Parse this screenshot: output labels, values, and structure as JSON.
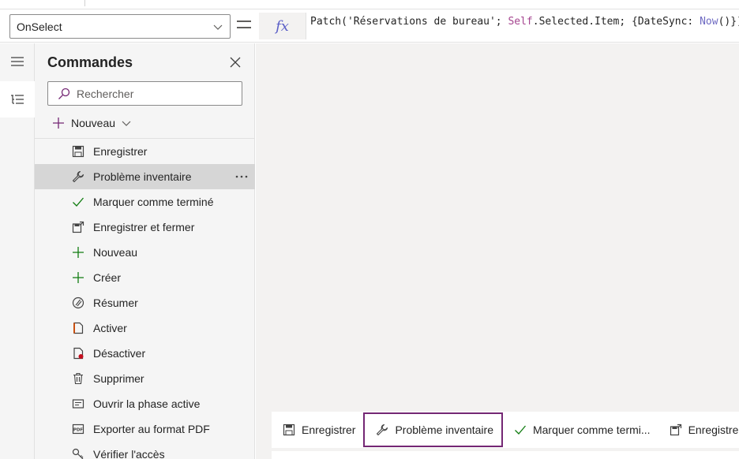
{
  "formula": {
    "property": "OnSelect",
    "fx_label": "fx",
    "parts": {
      "p1": "Patch('Réservations de bureau'; ",
      "p2": "Self",
      "p3": ".Selected.Item; {DateSync: ",
      "p4": "Now",
      "p5": "()})"
    }
  },
  "panel": {
    "title": "Commandes",
    "search_placeholder": "Rechercher",
    "new_label": "Nouveau",
    "commands": [
      {
        "label": "Enregistrer",
        "icon": "save-icon"
      },
      {
        "label": "Problème inventaire",
        "icon": "wrench-icon",
        "selected": true
      },
      {
        "label": "Marquer comme terminé",
        "icon": "checkmark-icon"
      },
      {
        "label": "Enregistrer et fermer",
        "icon": "save-close-icon"
      },
      {
        "label": "Nouveau",
        "icon": "plus-icon"
      },
      {
        "label": "Créer",
        "icon": "plus-icon"
      },
      {
        "label": "Résumer",
        "icon": "summarize-icon"
      },
      {
        "label": "Activer",
        "icon": "activate-icon"
      },
      {
        "label": "Désactiver",
        "icon": "deactivate-icon"
      },
      {
        "label": "Supprimer",
        "icon": "trash-icon"
      },
      {
        "label": "Ouvrir la phase active",
        "icon": "stage-icon"
      },
      {
        "label": "Exporter au format PDF",
        "icon": "pdf-icon"
      },
      {
        "label": "Vérifier l'accès",
        "icon": "key-icon"
      }
    ]
  },
  "commandbar": {
    "items": [
      {
        "label": "Enregistrer",
        "icon": "save-icon"
      },
      {
        "label": "Problème inventaire",
        "icon": "wrench-icon",
        "focused": true
      },
      {
        "label": "Marquer comme termi...",
        "icon": "checkmark-icon"
      },
      {
        "label": "Enregistrer",
        "icon": "save-close-icon"
      }
    ]
  },
  "colors": {
    "accent": "#742774",
    "green": "#107c10",
    "orange": "#ca5010",
    "red": "#c50f1f"
  }
}
